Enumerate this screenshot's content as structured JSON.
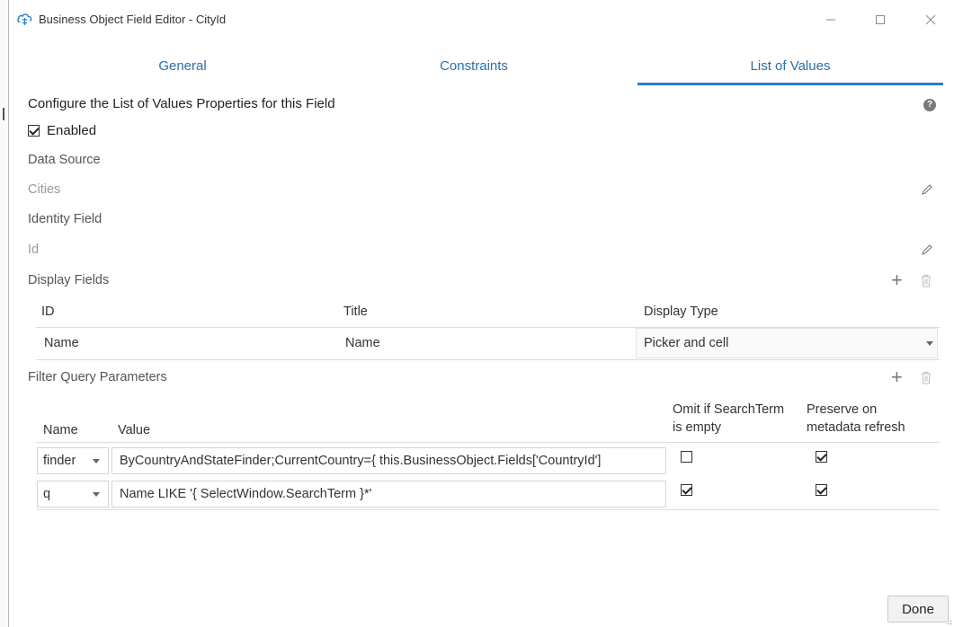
{
  "window": {
    "title": "Business Object Field Editor - CityId"
  },
  "tabs": [
    {
      "label": "General",
      "active": false
    },
    {
      "label": "Constraints",
      "active": false
    },
    {
      "label": "List of Values",
      "active": true
    }
  ],
  "lov": {
    "heading": "Configure the List of Values Properties for this Field",
    "enabled_label": "Enabled",
    "enabled": true,
    "data_source_label": "Data Source",
    "data_source_value": "Cities",
    "identity_field_label": "Identity Field",
    "identity_field_value": "Id",
    "display_fields_label": "Display Fields",
    "display_fields": {
      "headers": [
        "ID",
        "Title",
        "Display Type"
      ],
      "rows": [
        {
          "id": "Name",
          "title": "Name",
          "display_type": "Picker and cell"
        }
      ]
    },
    "filter_label": "Filter Query Parameters",
    "filter": {
      "headers": {
        "name": "Name",
        "value": "Value",
        "omit_line1": "Omit if SearchTerm",
        "omit_line2": "is empty",
        "preserve_line1": "Preserve on",
        "preserve_line2": "metadata refresh"
      },
      "rows": [
        {
          "name": "finder",
          "value": "ByCountryAndStateFinder;CurrentCountry={ this.BusinessObject.Fields['CountryId']",
          "omit": false,
          "preserve": true
        },
        {
          "name": "q",
          "value": "Name LIKE '{ SelectWindow.SearchTerm }*'",
          "omit": true,
          "preserve": true
        }
      ]
    }
  },
  "footer": {
    "done_label": "Done"
  },
  "colors": {
    "accent": "#2b7bc6",
    "tab_text": "#2a6fa8"
  }
}
